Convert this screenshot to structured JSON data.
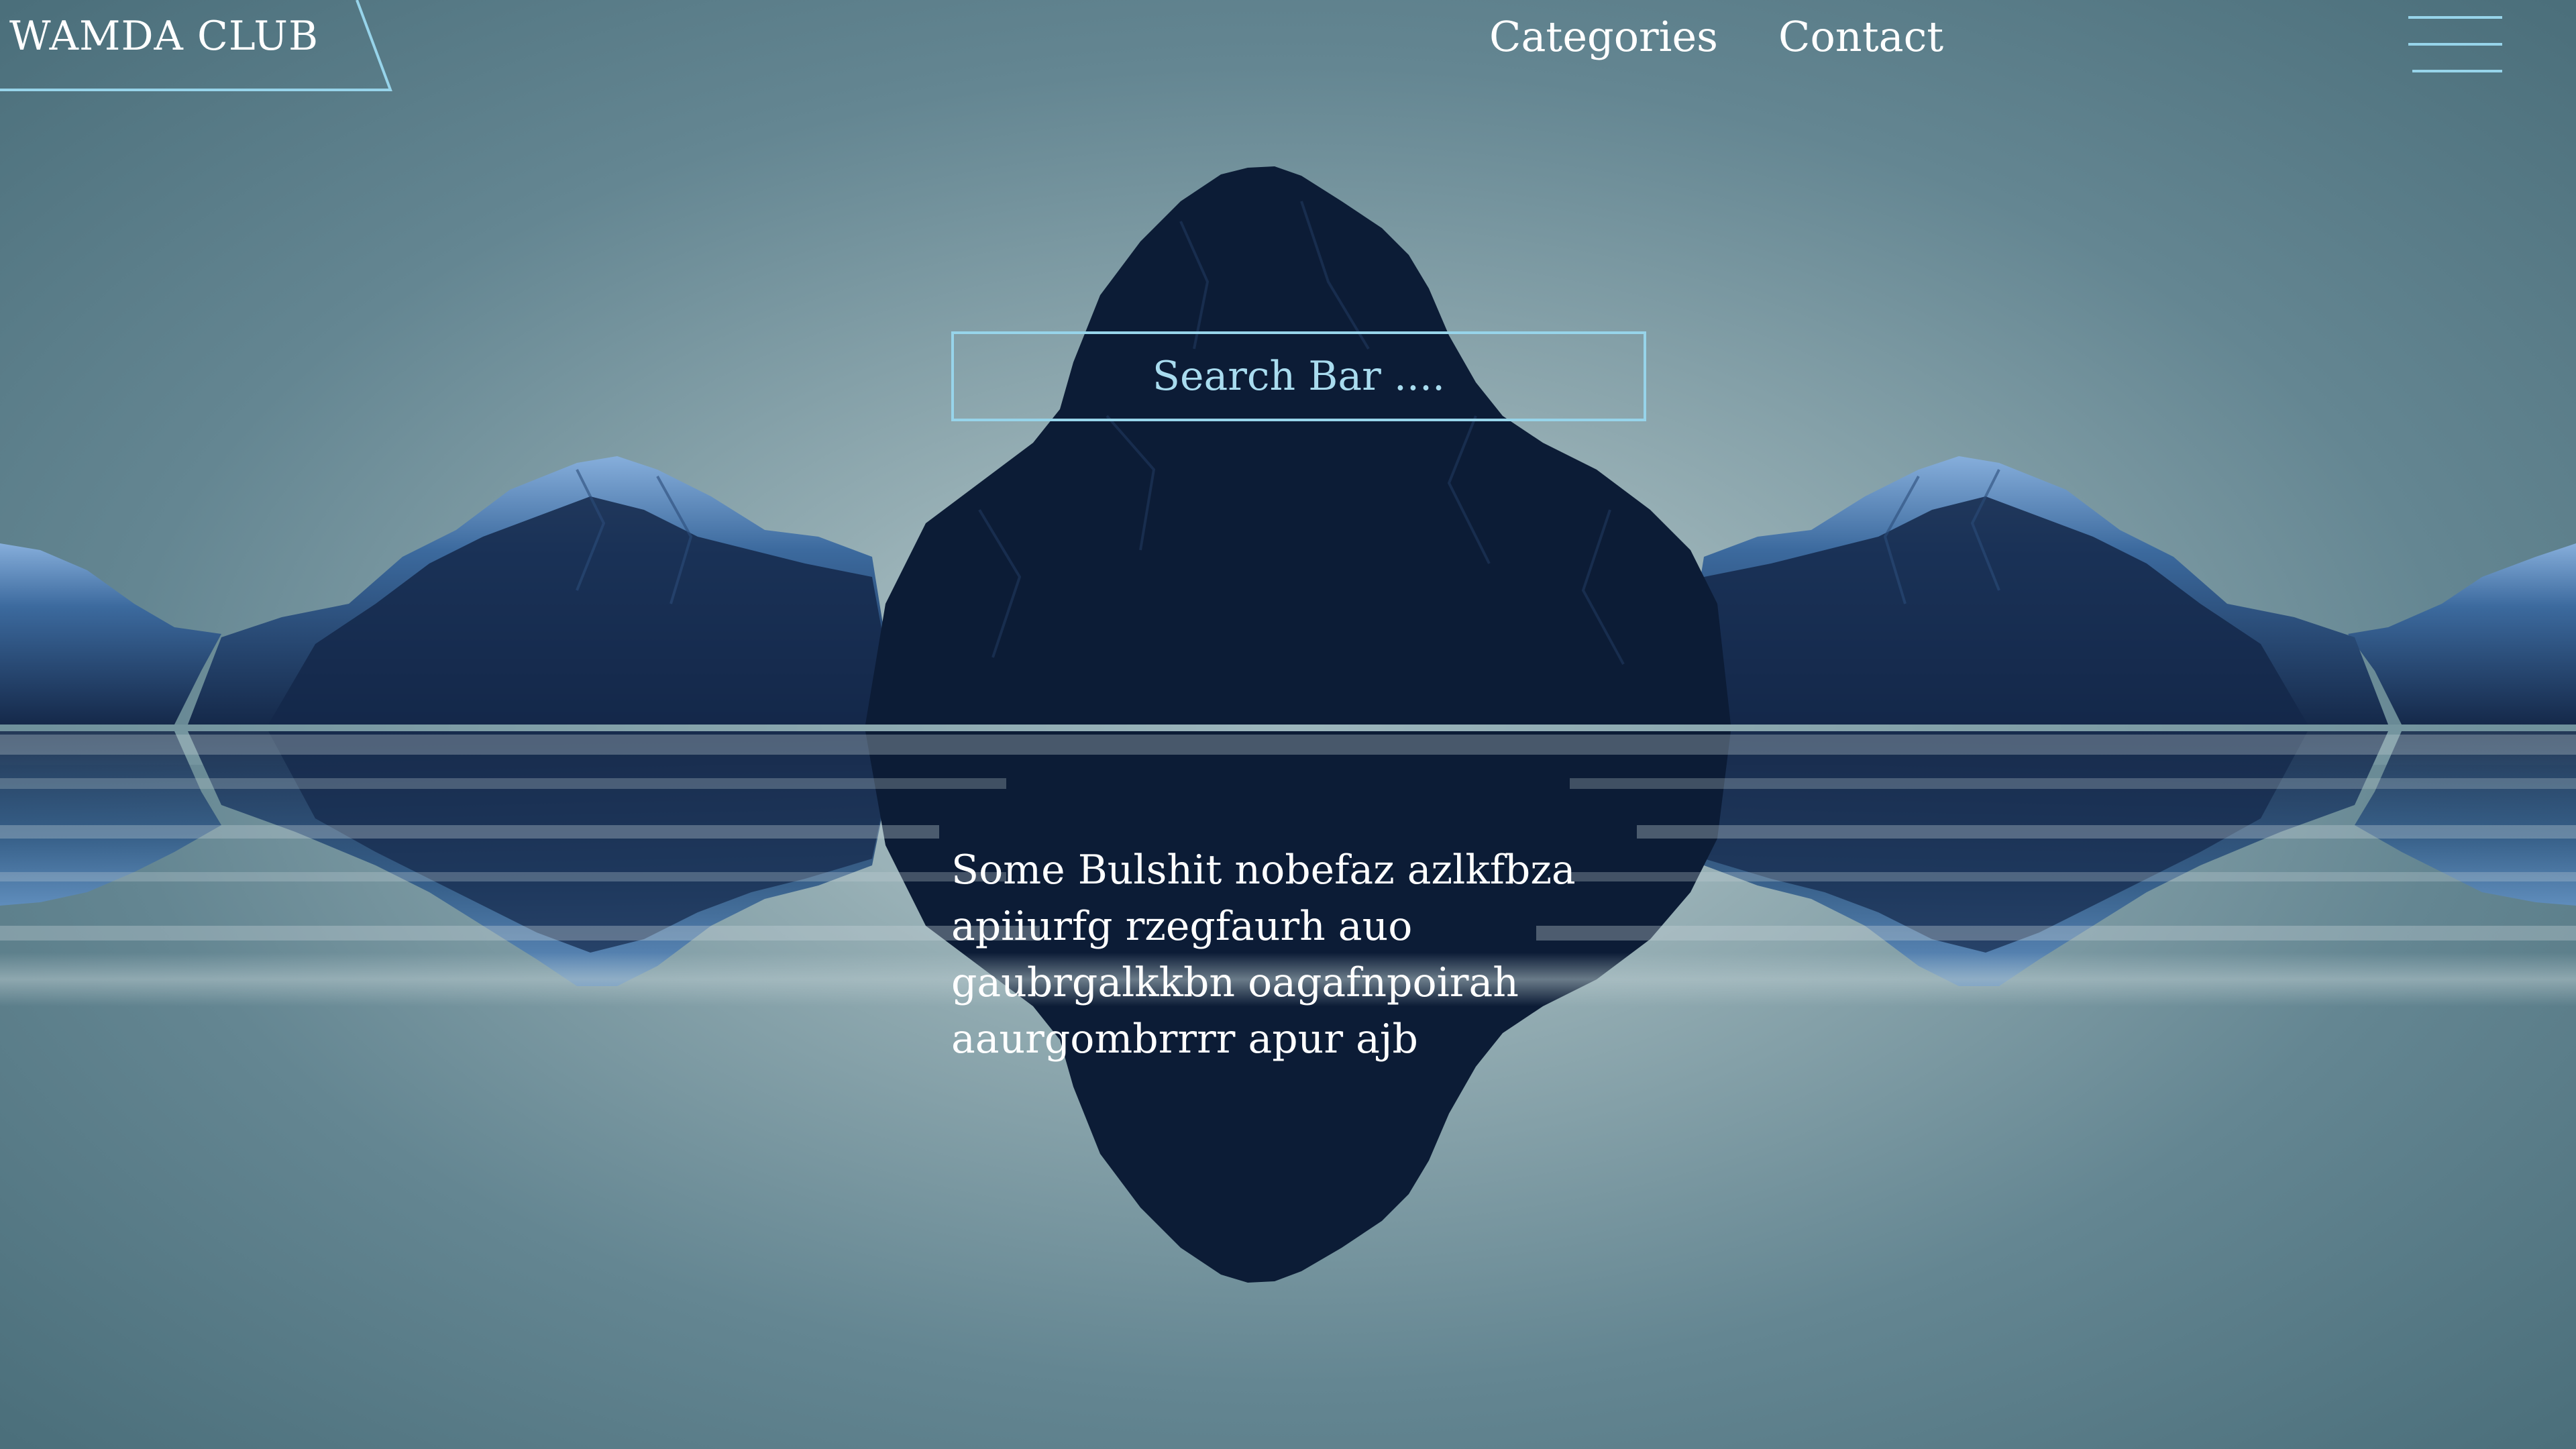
{
  "brand": {
    "name": "WAMDA CLUB"
  },
  "nav": {
    "links": [
      {
        "label": "Categories"
      },
      {
        "label": "Contact"
      }
    ],
    "menu_icon": "hamburger-menu-icon"
  },
  "search": {
    "placeholder": "Search Bar ...."
  },
  "content": {
    "text": "Some Bulshit nobefaz azlkfbza apiiurfg rzegfaurh auo gaubrgalkkbn oagafnpoirah aaurgombrrrr apur ajb"
  },
  "colors": {
    "background": "#4f7480",
    "mountain": "#0c1c36",
    "mountain_highlight": "#5b8fc9",
    "accent": "#97d4ea",
    "text": "#ffffff"
  }
}
